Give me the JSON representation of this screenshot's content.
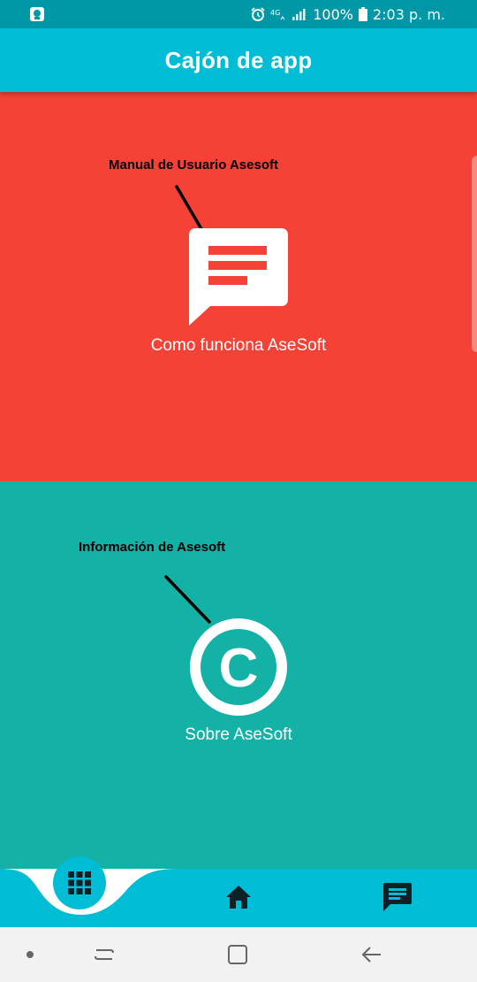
{
  "status_bar": {
    "battery": "100%",
    "time": "2:03 p. m.",
    "icons": [
      "app-notification-icon",
      "alarm-icon",
      "4g-icon",
      "signal-icon",
      "battery-icon"
    ]
  },
  "app_bar": {
    "title": "Cajón de app"
  },
  "cards": [
    {
      "annotation": "Manual de Usuario Asesoft",
      "icon": "chat-message-icon",
      "label": "Como funciona AseSoft",
      "color": "#f44336"
    },
    {
      "annotation": "Información de Asesoft",
      "icon": "copyright-icon",
      "label": "Sobre AseSoft",
      "color": "#14b1a6"
    }
  ],
  "bottom_nav": {
    "items": [
      "apps-grid-icon",
      "home-icon",
      "chat-icon"
    ],
    "color": "#00bcd4"
  },
  "system_nav": {
    "items": [
      "dot-icon",
      "recent-apps-icon",
      "home-square-icon",
      "back-icon"
    ]
  }
}
